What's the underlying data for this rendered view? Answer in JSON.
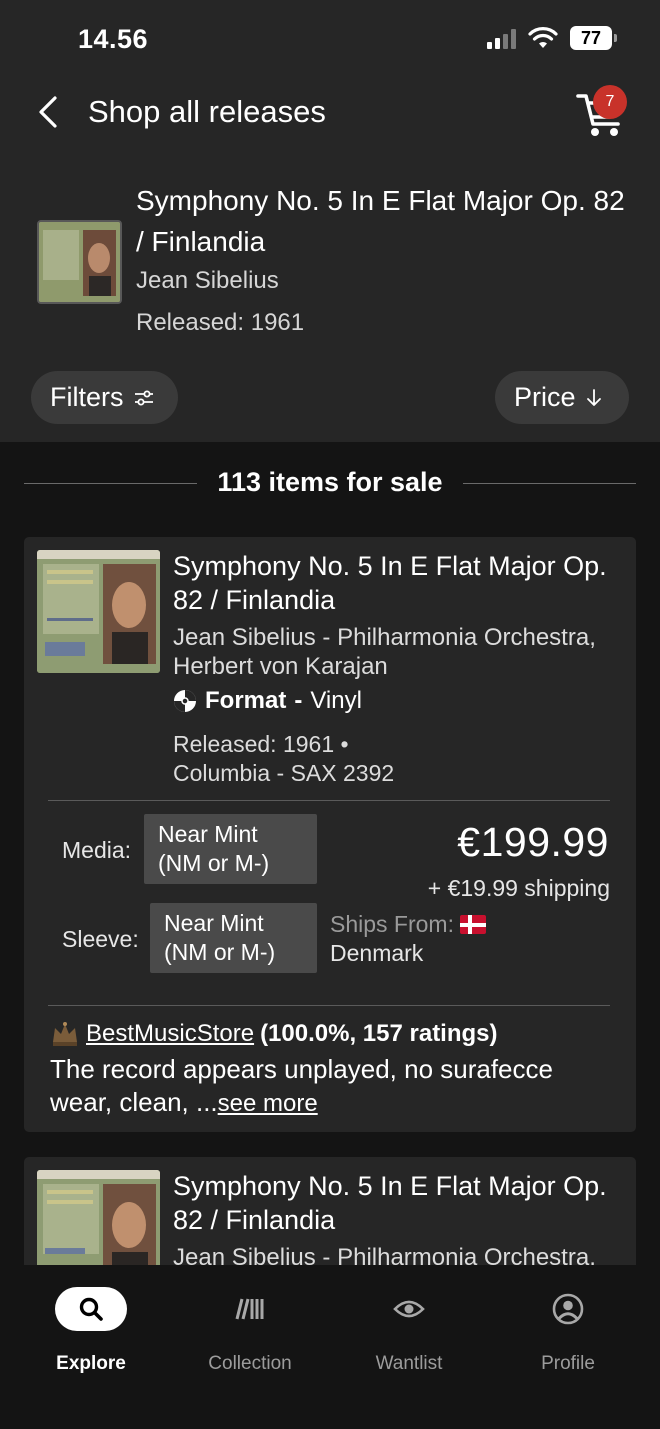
{
  "status_bar": {
    "time": "14.56",
    "battery": "77"
  },
  "header": {
    "title": "Shop all releases",
    "cart_count": "7"
  },
  "release": {
    "title": "Symphony No. 5 In E Flat Major Op. 82 / Finlandia",
    "artist": "Jean Sibelius",
    "released": "Released: 1961"
  },
  "controls": {
    "filters_label": "Filters",
    "sort_label": "Price"
  },
  "items_count": "113 items for sale",
  "listings": [
    {
      "title": "Symphony No. 5 In E Flat Major Op. 82 / Finlandia",
      "artist": "Jean Sibelius - Philharmonia Orchestra, Herbert von Karajan",
      "format_label": "Format",
      "format_sep": "-",
      "format_value": "Vinyl",
      "released": "Released: 1961 •",
      "label": "Columbia - SAX 2392",
      "media_label": "Media:",
      "media_condition": "Near Mint (NM or M-)",
      "sleeve_label": "Sleeve:",
      "sleeve_condition": "Near Mint (NM or M-)",
      "price": "€199.99",
      "shipping": "+ €19.99 shipping",
      "ships_from_label": "Ships From:",
      "ships_from_country": "Denmark",
      "seller": "BestMusicStore",
      "seller_rating": "(100.0%, 157 ratings)",
      "comment": "The record appears unplayed, no surafecce wear, clean, ...",
      "see_more": "see more"
    },
    {
      "title": "Symphony No. 5 In E Flat Major Op. 82 / Finlandia",
      "artist": "Jean Sibelius - Philharmonia Orchestra,"
    }
  ],
  "bottom_nav": [
    {
      "label": "Explore",
      "icon": "search-icon",
      "active": true
    },
    {
      "label": "Collection",
      "icon": "collection-icon",
      "active": false
    },
    {
      "label": "Wantlist",
      "icon": "eye-icon",
      "active": false
    },
    {
      "label": "Profile",
      "icon": "profile-icon",
      "active": false
    }
  ],
  "colors": {
    "badge": "#c8322a",
    "background": "#141414",
    "surface": "#262626",
    "chip": "#4a4a4a"
  }
}
